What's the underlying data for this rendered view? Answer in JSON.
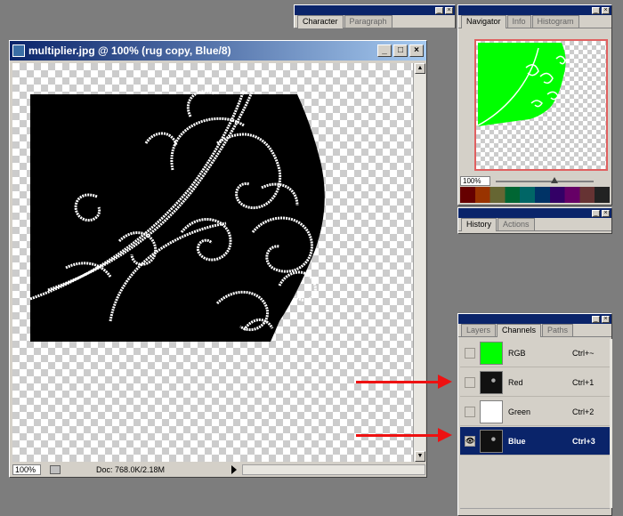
{
  "document": {
    "title": "multiplier.jpg @ 100% (rug copy, Blue/8)",
    "zoom": "100%",
    "doc_info": "Doc: 768.0K/2.18M"
  },
  "char_panel": {
    "tabs": [
      "Character",
      "Paragraph"
    ]
  },
  "nav_panel": {
    "tabs": [
      "Navigator",
      "Info",
      "Histogram"
    ],
    "zoom": "100%"
  },
  "history_panel": {
    "tabs": [
      "History",
      "Actions"
    ]
  },
  "channels_panel": {
    "tabs": [
      "Layers",
      "Channels",
      "Paths"
    ],
    "rows": [
      {
        "name": "RGB",
        "shortcut": "Ctrl+~",
        "visible": false,
        "selected": false
      },
      {
        "name": "Red",
        "shortcut": "Ctrl+1",
        "visible": false,
        "selected": false
      },
      {
        "name": "Green",
        "shortcut": "Ctrl+2",
        "visible": false,
        "selected": false
      },
      {
        "name": "Blue",
        "shortcut": "Ctrl+3",
        "visible": true,
        "selected": true
      }
    ]
  },
  "colors": {
    "accent_green": "#00ff00",
    "selection_blue": "#0a246a",
    "arrow_red": "#ee1111"
  }
}
